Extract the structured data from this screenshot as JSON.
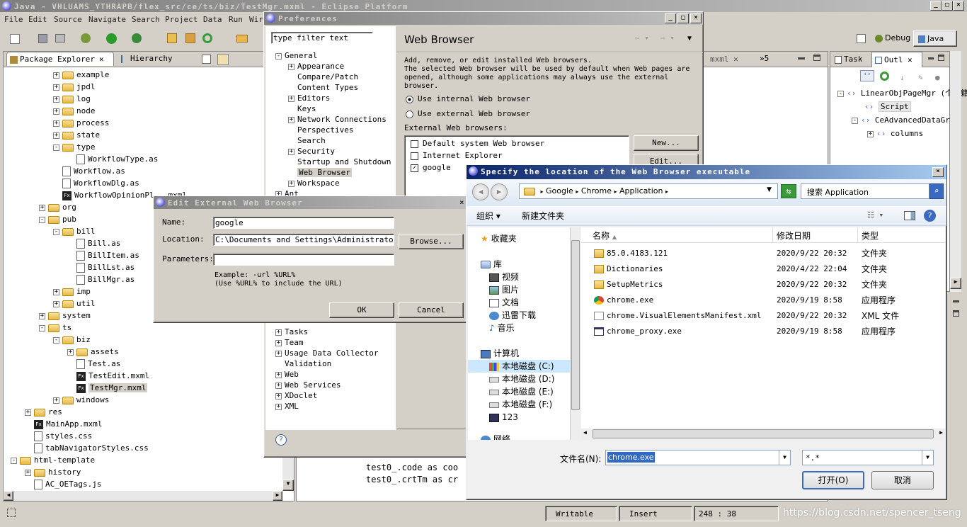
{
  "app": {
    "title": "Java - VHLUAMS_YTHRAPB/flex_src/ce/ts/biz/TestMgr.mxml - Eclipse Platform"
  },
  "menu": [
    "File",
    "Edit",
    "Source",
    "Navigate",
    "Search",
    "Project",
    "Data",
    "Run",
    "Wir"
  ],
  "perspectives": {
    "debug": "Debug",
    "java": "Java"
  },
  "left_tabs": {
    "package_explorer": "Package Explorer",
    "hierarchy": "Hierarchy"
  },
  "tree": [
    {
      "label": "example",
      "type": "folder",
      "level": 4,
      "exp": "+"
    },
    {
      "label": "jpdl",
      "type": "folder",
      "level": 4,
      "exp": "+"
    },
    {
      "label": "log",
      "type": "folder",
      "level": 4,
      "exp": "+"
    },
    {
      "label": "node",
      "type": "folder",
      "level": 4,
      "exp": "+"
    },
    {
      "label": "process",
      "type": "folder",
      "level": 4,
      "exp": "+"
    },
    {
      "label": "state",
      "type": "folder",
      "level": 4,
      "exp": "+"
    },
    {
      "label": "type",
      "type": "folder",
      "level": 4,
      "exp": "-"
    },
    {
      "label": "WorkflowType.as",
      "type": "as",
      "level": 5,
      "exp": ""
    },
    {
      "label": "Workflow.as",
      "type": "as",
      "level": 4,
      "exp": ""
    },
    {
      "label": "WorkflowDlg.as",
      "type": "as",
      "level": 4,
      "exp": ""
    },
    {
      "label": "WorkflowOpinionPl...mxml",
      "type": "fx",
      "level": 4,
      "exp": ""
    },
    {
      "label": "org",
      "type": "folder",
      "level": 3,
      "exp": "+"
    },
    {
      "label": "pub",
      "type": "folder",
      "level": 3,
      "exp": "-"
    },
    {
      "label": "bill",
      "type": "folder",
      "level": 4,
      "exp": "-"
    },
    {
      "label": "Bill.as",
      "type": "as",
      "level": 5,
      "exp": ""
    },
    {
      "label": "BillItem.as",
      "type": "as",
      "level": 5,
      "exp": ""
    },
    {
      "label": "BillLst.as",
      "type": "as",
      "level": 5,
      "exp": ""
    },
    {
      "label": "BillMgr.as",
      "type": "as",
      "level": 5,
      "exp": ""
    },
    {
      "label": "imp",
      "type": "folder",
      "level": 4,
      "exp": "+"
    },
    {
      "label": "util",
      "type": "folder",
      "level": 4,
      "exp": "+"
    },
    {
      "label": "system",
      "type": "folder",
      "level": 3,
      "exp": "+"
    },
    {
      "label": "ts",
      "type": "folder",
      "level": 3,
      "exp": "-"
    },
    {
      "label": "biz",
      "type": "folder",
      "level": 4,
      "exp": "-"
    },
    {
      "label": "assets",
      "type": "folder",
      "level": 5,
      "exp": "+"
    },
    {
      "label": "Test.as",
      "type": "as",
      "level": 5,
      "exp": ""
    },
    {
      "label": "TestEdit.mxml",
      "type": "fx",
      "level": 5,
      "exp": ""
    },
    {
      "label": "TestMgr.mxml",
      "type": "fx",
      "level": 5,
      "exp": "",
      "selected": true
    },
    {
      "label": "windows",
      "type": "folder",
      "level": 4,
      "exp": "+"
    },
    {
      "label": "res",
      "type": "folder",
      "level": 2,
      "exp": "+"
    },
    {
      "label": "MainApp.mxml",
      "type": "fx",
      "level": 2,
      "exp": ""
    },
    {
      "label": "styles.css",
      "type": "as",
      "level": 2,
      "exp": ""
    },
    {
      "label": "tabNavigatorStyles.css",
      "type": "as",
      "level": 2,
      "exp": ""
    },
    {
      "label": "html-template",
      "type": "folder",
      "level": 1,
      "exp": "-"
    },
    {
      "label": "history",
      "type": "folder",
      "level": 2,
      "exp": "+"
    },
    {
      "label": "AC_OETags.js",
      "type": "as",
      "level": 2,
      "exp": ""
    }
  ],
  "editor": {
    "tab1": "mxml",
    "tab2": "»5",
    "code": [
      "test0_.code as coo",
      "test0_.crtTm as cr"
    ]
  },
  "outline": {
    "task_tab": "Task",
    "outline_tab": "Outl",
    "items": [
      "LinearObjPageMgr (个人籍",
      "Script",
      "CeAdvancedDataGrid",
      "columns"
    ]
  },
  "status": {
    "writable": "Writable",
    "insert": "Insert",
    "position": "248 : 38",
    "watermark": "https://blog.csdn.net/spencer_tseng"
  },
  "prefs": {
    "title": "Preferences",
    "filter_value": "type filter text",
    "page_title": "Web Browser",
    "desc": [
      "Add, remove, or edit installed Web browsers.",
      "The selected Web browser will be used by default when Web pages are",
      "opened, although some applications may always use the external",
      "browser."
    ],
    "radio_internal": "Use internal Web browser",
    "radio_external": "Use external Web browser",
    "external_label": "External Web browsers:",
    "browsers": [
      "Default system Web browser",
      "Internet Explorer",
      "google"
    ],
    "new_btn": "New...",
    "edit_btn": "Edit...",
    "tree_top": [
      {
        "label": "General",
        "exp": "-",
        "level": 0
      },
      {
        "label": "Appearance",
        "exp": "+",
        "level": 1
      },
      {
        "label": "Compare/Patch",
        "exp": "",
        "level": 1
      },
      {
        "label": "Content Types",
        "exp": "",
        "level": 1
      },
      {
        "label": "Editors",
        "exp": "+",
        "level": 1
      },
      {
        "label": "Keys",
        "exp": "",
        "level": 1
      },
      {
        "label": "Network Connections",
        "exp": "+",
        "level": 1
      },
      {
        "label": "Perspectives",
        "exp": "",
        "level": 1
      },
      {
        "label": "Search",
        "exp": "",
        "level": 1
      },
      {
        "label": "Security",
        "exp": "+",
        "level": 1
      },
      {
        "label": "Startup and Shutdown",
        "exp": "",
        "level": 1
      },
      {
        "label": "Web Browser",
        "exp": "",
        "level": 1,
        "selected": true
      },
      {
        "label": "Workspace",
        "exp": "+",
        "level": 1
      },
      {
        "label": "Ant",
        "exp": "+",
        "level": 0
      }
    ],
    "tree_bottom": [
      "Tasks",
      "Team",
      "Usage Data Collector",
      "Validation",
      "Web",
      "Web Services",
      "XDoclet",
      "XML"
    ]
  },
  "edit_dialog": {
    "title": "Edit External Web Browser",
    "name_label": "Name:",
    "name_value": "google",
    "location_label": "Location:",
    "location_value": "C:\\Documents and Settings\\Administrator\\Lo",
    "params_label": "Parameters:",
    "params_value": "",
    "browse_btn": "Browse...",
    "example": [
      "Example: -url %URL%",
      "(Use %URL% to include the URL)"
    ],
    "ok": "OK",
    "cancel": "Cancel"
  },
  "file_dialog": {
    "title": "Specify the location of the Web Browser executable",
    "path": [
      "Google",
      "Chrome",
      "Application"
    ],
    "search_placeholder": "搜索 Application",
    "organize": "组织",
    "new_folder": "新建文件夹",
    "sidebar": {
      "favorites": "收藏夹",
      "library": "库",
      "videos": "视频",
      "pictures": "图片",
      "documents": "文档",
      "downloads": "迅雷下载",
      "music": "音乐",
      "computer": "计算机",
      "drives": [
        "本地磁盘 (C:)",
        "本地磁盘 (D:)",
        "本地磁盘 (E:)",
        "本地磁盘 (F:)"
      ],
      "cd": "123",
      "network": "网络"
    },
    "columns": [
      "名称",
      "修改日期",
      "类型"
    ],
    "files": [
      {
        "name": "85.0.4183.121",
        "date": "2020/9/22 20:32",
        "type": "文件夹",
        "icon": "folder"
      },
      {
        "name": "Dictionaries",
        "date": "2020/4/22 22:04",
        "type": "文件夹",
        "icon": "folder"
      },
      {
        "name": "SetupMetrics",
        "date": "2020/9/22 20:32",
        "type": "文件夹",
        "icon": "folder"
      },
      {
        "name": "chrome.exe",
        "date": "2020/9/19 8:58",
        "type": "应用程序",
        "icon": "chrome"
      },
      {
        "name": "chrome.VisualElementsManifest.xml",
        "date": "2020/9/22 20:32",
        "type": "XML 文件",
        "icon": "xml"
      },
      {
        "name": "chrome_proxy.exe",
        "date": "2020/9/19 8:58",
        "type": "应用程序",
        "icon": "exe"
      }
    ],
    "filename_label": "文件名(N):",
    "filename_value": "chrome.exe",
    "filter_value": "*.*",
    "open_btn": "打开(O)",
    "cancel_btn": "取消"
  },
  "colors": {
    "title_active": "#0a246a",
    "title_gradient_end": "#a6caf0",
    "selection": "#316ac5",
    "win7_highlight": "#cce8ff"
  }
}
